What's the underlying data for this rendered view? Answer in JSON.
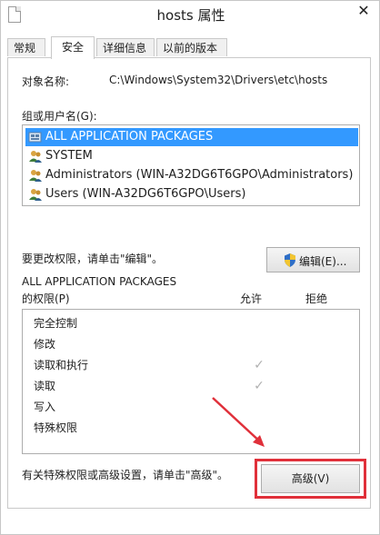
{
  "window": {
    "title": "hosts 属性",
    "close": "✕"
  },
  "tabs": [
    {
      "label": "常规"
    },
    {
      "label": "安全"
    },
    {
      "label": "详细信息"
    },
    {
      "label": "以前的版本"
    }
  ],
  "object": {
    "label": "对象名称:",
    "value": "C:\\Windows\\System32\\Drivers\\etc\\hosts"
  },
  "groups": {
    "label": "组或用户名(G):",
    "items": [
      {
        "label": "ALL APPLICATION PACKAGES",
        "selected": true
      },
      {
        "label": "SYSTEM",
        "selected": false
      },
      {
        "label": "Administrators (WIN-A32DG6T6GPO\\Administrators)",
        "selected": false
      },
      {
        "label": "Users (WIN-A32DG6T6GPO\\Users)",
        "selected": false
      }
    ]
  },
  "edit": {
    "hint": "要更改权限，请单击\"编辑\"。",
    "button_label": "编辑(E)..."
  },
  "permissions": {
    "for_label": "ALL APPLICATION PACKAGES",
    "label": "的权限(P)",
    "allow_header": "允许",
    "deny_header": "拒绝",
    "rows": [
      {
        "name": "完全控制",
        "allow": false,
        "deny": false
      },
      {
        "name": "修改",
        "allow": false,
        "deny": false
      },
      {
        "name": "读取和执行",
        "allow": true,
        "deny": false
      },
      {
        "name": "读取",
        "allow": true,
        "deny": false
      },
      {
        "name": "写入",
        "allow": false,
        "deny": false
      },
      {
        "name": "特殊权限",
        "allow": false,
        "deny": false
      }
    ],
    "check_glyph": "✓"
  },
  "advanced": {
    "hint": "有关特殊权限或高级设置，请单击\"高级\"。",
    "button_label": "高级(V)"
  },
  "colors": {
    "selection": "#3399ff",
    "annotation": "#e0303a"
  }
}
